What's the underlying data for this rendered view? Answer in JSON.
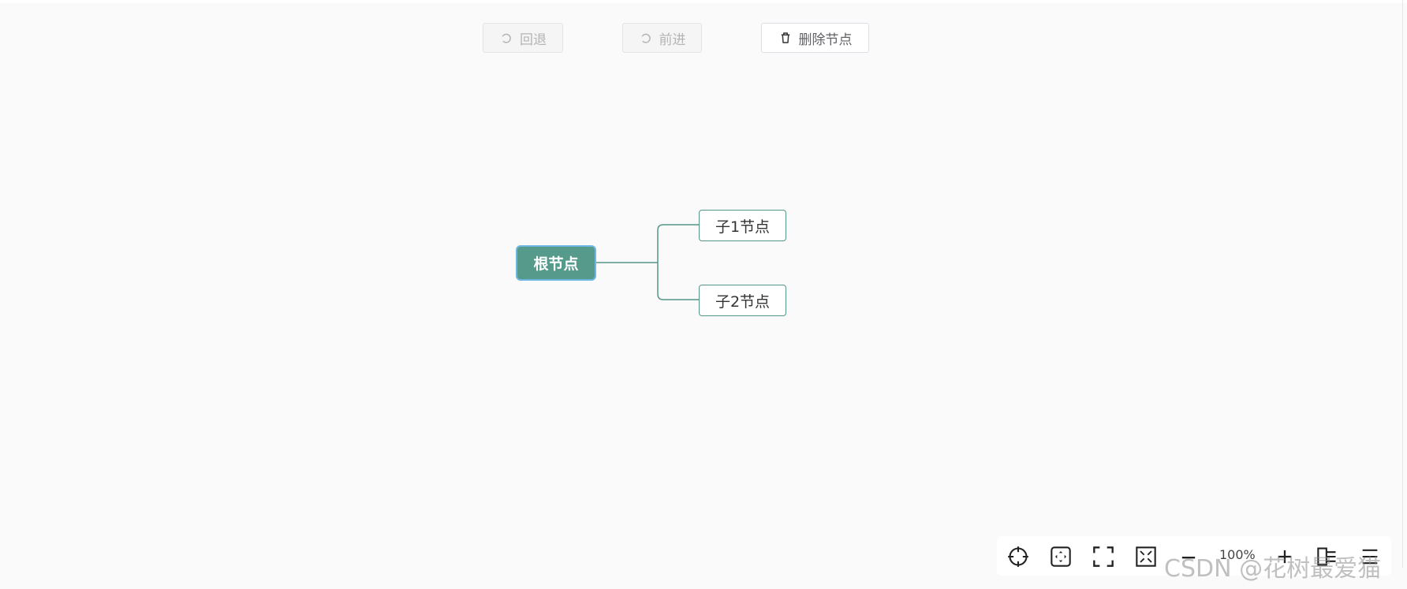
{
  "toolbar_top": {
    "undo_label": "回退",
    "redo_label": "前进",
    "delete_label": "删除节点"
  },
  "mindmap": {
    "root": "根节点",
    "children": [
      "子1节点",
      "子2节点"
    ]
  },
  "bottom_toolbar": {
    "zoom": "100%",
    "icons": [
      "locate-icon",
      "fit-icon",
      "fullscreen-icon",
      "expand-icon",
      "zoom-out-icon",
      "zoom-in-icon",
      "mindmap-layout-icon",
      "structure-icon"
    ]
  },
  "watermark": "CSDN @花树最爱猫",
  "colors": {
    "node_fill": "#559a8b",
    "node_border": "#549688",
    "selection": "#6fb6e3"
  }
}
